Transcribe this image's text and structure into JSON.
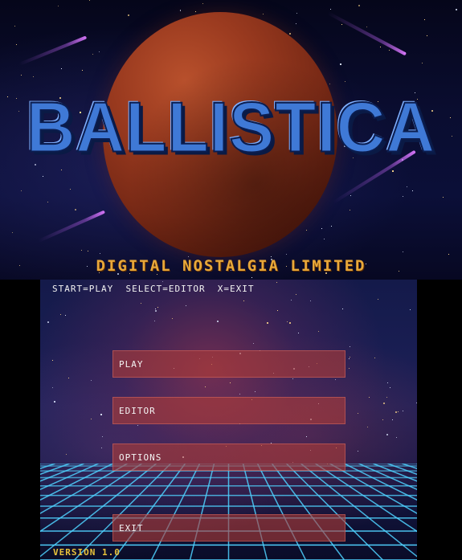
{
  "top_screen": {
    "game_title": "BALLISTICA",
    "studio_name": "DIGITAL NOSTALGIA LIMITED"
  },
  "bottom_screen": {
    "controls_hint": "START=PLAY  SELECT=EDITOR  X=EXIT",
    "menu": [
      {
        "label": "PLAY"
      },
      {
        "label": "EDITOR"
      },
      {
        "label": "OPTIONS"
      },
      {
        "label": "EXIT"
      }
    ],
    "version": "VERSION 1.0"
  },
  "colors": {
    "title_blue": "#3f79d6",
    "studio_gold": "#e8a83a",
    "version_yellow": "#e8c23a",
    "button_red": "#af3c37",
    "grid_cyan": "#4fd2ff"
  }
}
